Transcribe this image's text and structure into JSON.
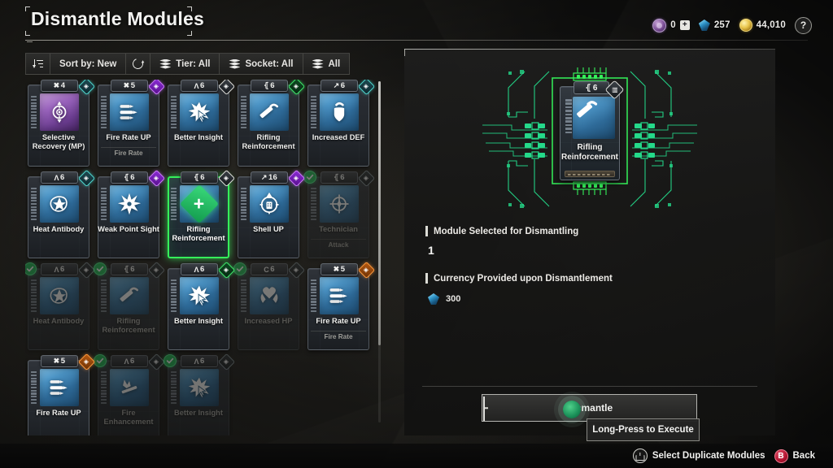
{
  "header": {
    "title": "Dismantle Modules",
    "help_label": "?"
  },
  "currency": {
    "amplifier": {
      "icon": "amp-coin-icon",
      "value": "0",
      "plus": "+"
    },
    "gem": {
      "icon": "gem-icon",
      "value": "257"
    },
    "gold": {
      "icon": "gold-coin-icon",
      "value": "44,010"
    }
  },
  "toolbar": {
    "sort_toggle_icon": "sort-descending-icon",
    "sort_label": "Sort by: New",
    "refresh_icon": "refresh-icon",
    "tier_label": "Tier: All",
    "socket_label": "Socket: All",
    "all_label": "All"
  },
  "grid": {
    "cards": [
      {
        "name": "Selective Recovery (MP)",
        "tier": "4",
        "tier_glyph": "✖",
        "socket": "cyan",
        "art": "purple",
        "art_icon": "crosshair-arrows-icon",
        "sub": "",
        "state": "normal"
      },
      {
        "name": "Fire Rate UP",
        "tier": "5",
        "tier_glyph": "✖",
        "socket": "purple",
        "art": "blue",
        "art_icon": "bullets-icon",
        "sub": "Fire Rate",
        "state": "normal"
      },
      {
        "name": "Better Insight",
        "tier": "6",
        "tier_glyph": "Λ",
        "socket": "white",
        "art": "blue",
        "art_icon": "burst-cursor-icon",
        "sub": "",
        "state": "normal"
      },
      {
        "name": "Rifling Reinforcement",
        "tier": "6",
        "tier_glyph": "⦃",
        "socket": "green",
        "art": "blue",
        "art_icon": "barrel-icon",
        "sub": "",
        "state": "normal"
      },
      {
        "name": "Increased DEF",
        "tier": "6",
        "tier_glyph": "↗",
        "socket": "cyan",
        "art": "blue",
        "art_icon": "shield-icon",
        "sub": "",
        "state": "normal"
      },
      {
        "name": "Heat Antibody",
        "tier": "6",
        "tier_glyph": "Λ",
        "socket": "cyan",
        "art": "blue",
        "art_icon": "heat-shard-icon",
        "sub": "",
        "state": "normal"
      },
      {
        "name": "Weak Point Sight",
        "tier": "6",
        "tier_glyph": "⦃",
        "socket": "purple",
        "art": "blue",
        "art_icon": "starburst-icon",
        "sub": "",
        "state": "normal"
      },
      {
        "name": "Rifling Reinforcement",
        "tier": "6",
        "tier_glyph": "⦃",
        "socket": "white",
        "art": "blue",
        "art_icon": "barrel-icon",
        "sub": "",
        "state": "selected"
      },
      {
        "name": "Shell UP",
        "tier": "16",
        "tier_glyph": "↗",
        "socket": "purple",
        "art": "blue",
        "art_icon": "shell-up-icon",
        "sub": "",
        "state": "normal"
      },
      {
        "name": "Technician",
        "tier": "6",
        "tier_glyph": "⦃",
        "socket": "dim",
        "art": "blue",
        "art_icon": "compass-icon",
        "sub": "Attack",
        "state": "owned"
      },
      {
        "name": "Heat Antibody",
        "tier": "6",
        "tier_glyph": "Λ",
        "socket": "dim",
        "art": "blue",
        "art_icon": "heat-shard-icon",
        "sub": "",
        "state": "owned"
      },
      {
        "name": "Rifling Reinforcement",
        "tier": "6",
        "tier_glyph": "⦃",
        "socket": "dim",
        "art": "blue",
        "art_icon": "barrel-icon",
        "sub": "",
        "state": "owned"
      },
      {
        "name": "Better Insight",
        "tier": "6",
        "tier_glyph": "Λ",
        "socket": "green",
        "art": "blue",
        "art_icon": "burst-cursor-icon",
        "sub": "",
        "state": "normal"
      },
      {
        "name": "Increased HP",
        "tier": "6",
        "tier_glyph": "C",
        "socket": "dim",
        "art": "blue",
        "art_icon": "heart-hands-icon",
        "sub": "",
        "state": "owned"
      },
      {
        "name": "Fire Rate UP",
        "tier": "5",
        "tier_glyph": "✖",
        "socket": "orange",
        "art": "blue",
        "art_icon": "bullets-icon",
        "sub": "Fire Rate",
        "state": "normal"
      },
      {
        "name": "Fire Rate UP",
        "tier": "5",
        "tier_glyph": "✖",
        "socket": "orange",
        "art": "blue",
        "art_icon": "bullets-icon",
        "sub": "",
        "state": "normal"
      },
      {
        "name": "Fire Enhancement",
        "tier": "6",
        "tier_glyph": "Λ",
        "socket": "dim",
        "art": "blue",
        "art_icon": "fire-blade-icon",
        "sub": "",
        "state": "owned"
      },
      {
        "name": "Better Insight",
        "tier": "6",
        "tier_glyph": "Λ",
        "socket": "dim",
        "art": "blue",
        "art_icon": "burst-cursor-icon",
        "sub": "",
        "state": "owned"
      }
    ]
  },
  "detail": {
    "preview_card": {
      "name": "Rifling Reinforcement",
      "tier": "6",
      "tier_glyph": "⦃",
      "art_icon": "barrel-icon",
      "socket_icon": "socket-diamond-icon"
    },
    "selected_label": "Module Selected for Dismantling",
    "selected_count": "1",
    "currency_label": "Currency Provided upon Dismantlement",
    "currency_icon": "gem-icon",
    "currency_value": "300",
    "dismantle_label": "Dismantle",
    "tooltip": "Long-Press to Execute"
  },
  "bottom": {
    "select_icon": "left-stick-icon",
    "select_label": "Select Duplicate Modules",
    "back_button": "B",
    "back_label": "Back"
  },
  "colors": {
    "accent_green": "#35f05a",
    "check_green": "#1db954",
    "socket_cyan": "#4fd8d0",
    "socket_purple": "#cf7bff",
    "socket_orange": "#ff9a3c",
    "panel_bg": "#1a1a19"
  }
}
